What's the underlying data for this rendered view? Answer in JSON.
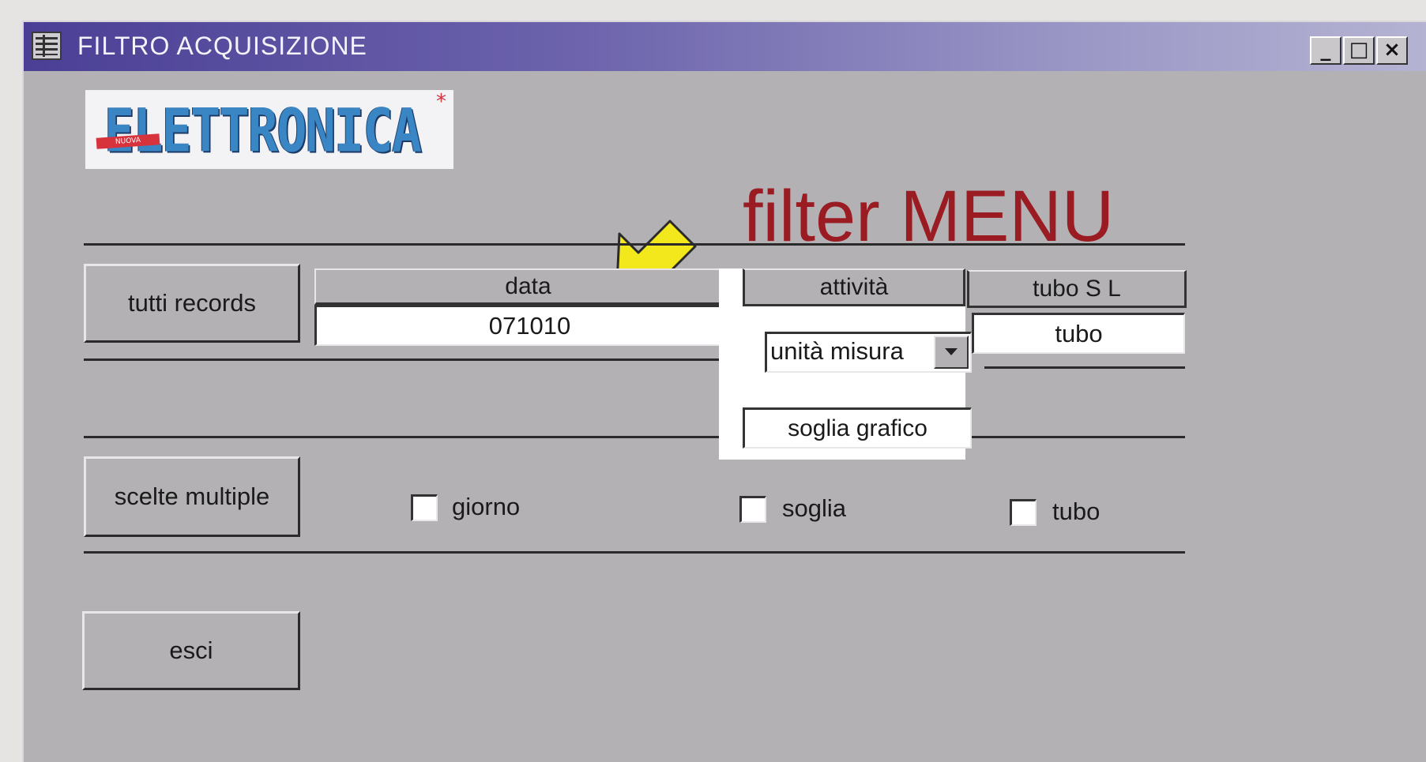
{
  "window": {
    "title": "FILTRO ACQUISIZIONE",
    "controls": {
      "minimize": "_",
      "maximize": "□",
      "close": "×"
    }
  },
  "logo": {
    "text": "ELETTRONICA",
    "tag": "NUOVA",
    "star": "*"
  },
  "headline": "filter MENU",
  "buttons": {
    "all_records": "tutti records",
    "multiple_choices": "scelte multiple",
    "exit": "esci"
  },
  "filter": {
    "data": {
      "header": "data",
      "value": "071010"
    },
    "activity": {
      "header": "attività",
      "unit_select": "unità misura",
      "threshold_field": "soglia grafico"
    },
    "tube": {
      "header": "tubo S L",
      "value": "tubo"
    }
  },
  "checkboxes": [
    {
      "label": "giorno",
      "checked": false
    },
    {
      "label": "soglia",
      "checked": false
    },
    {
      "label": "tubo",
      "checked": false
    }
  ],
  "colors": {
    "titlebar_start": "#4a3f95",
    "titlebar_end": "#b5b3d2",
    "window_bg": "#b3b1b4",
    "headline": "#9a1b22",
    "logo_blue": "#3a85c4",
    "arrow_yellow": "#f3e81c"
  },
  "icons": {
    "app": "form-icon",
    "combo_dropdown": "chevron-down-icon",
    "pointer": "yellow-arrow-icon"
  }
}
